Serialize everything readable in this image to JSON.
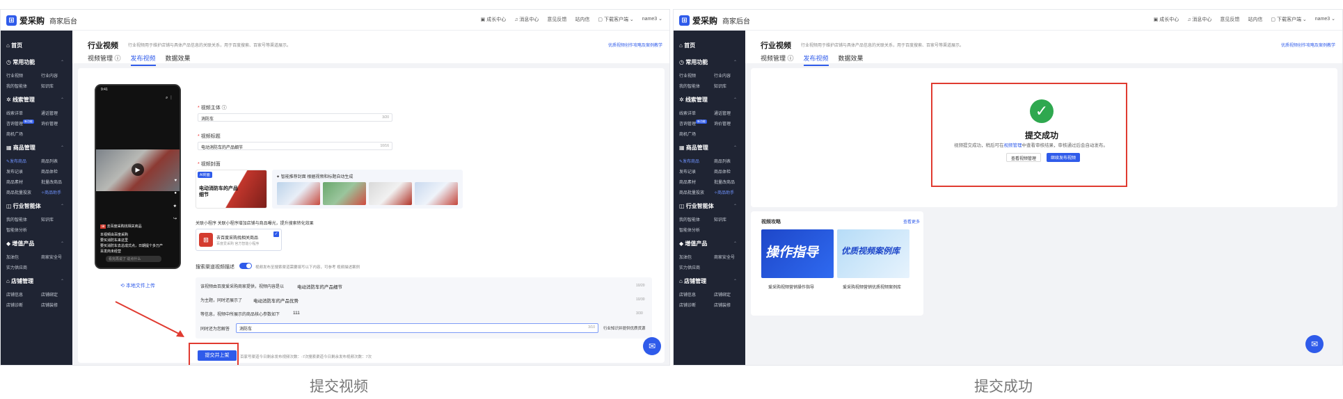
{
  "app": {
    "logo_text": "爱采购",
    "logo_sub": "商家后台",
    "top_nav": [
      "成长中心",
      "消息中心",
      "意见反馈",
      "站内信",
      "下载客户端",
      "name3"
    ]
  },
  "sidebar": {
    "home": "首页",
    "groups": [
      {
        "title": "常用功能",
        "items": [
          "行业视频",
          "行业内容",
          "我的智能体",
          "知识库"
        ]
      },
      {
        "title": "线索管理",
        "items": [
          "线索详单",
          "通话管理",
          "咨询管理",
          "询价管理",
          "商机广场"
        ],
        "badge": "新功能"
      },
      {
        "title": "商品管理",
        "items": [
          "发布商品",
          "商品列表",
          "发布记录",
          "商品体检",
          "商品素材",
          "批量改商品",
          "商品批量投放",
          "商品助手"
        ]
      },
      {
        "title": "行业智能体",
        "items": [
          "我的智能体",
          "知识库",
          "智能体分析"
        ]
      },
      {
        "title": "增值产品",
        "items": [
          "加油包",
          "商家安全号",
          "实力供应商"
        ]
      },
      {
        "title": "店铺管理",
        "items": [
          "店铺信息",
          "店铺绑定",
          "店铺诊断",
          "店铺装修"
        ]
      }
    ]
  },
  "header": {
    "title": "行业视频",
    "desc": "行业视频用于维护店铺与具体产品信息的关联关系，用于百度搜索、百家号等渠道展示。",
    "link": "优质视频创作攻略及案例教学",
    "tabs": [
      "视频管理 ⓘ",
      "发布视频",
      "数据效果"
    ]
  },
  "form": {
    "subject_label": "视频主体 ⓘ",
    "subject_value": "消防车",
    "subject_count": "3/20",
    "title_label": "视频标题",
    "title_value": "电动消防车的产品细节",
    "title_count": "10/16",
    "cover_label": "视频封面",
    "cover_tag": "AI封面",
    "cover_title": "电动消防车的产品细节",
    "smart_cover_title": "智能推荐封面 根据视频和标题自动生成",
    "mini_label": "关联小程序 关联小程序增加店铺与商品曝光，提升搜索转化效果",
    "mini_name": "去百度采购找相关商品",
    "mini_sub": "百度爱采购 官方智能小程序",
    "search_desc_label": "搜索渠道视频描述",
    "search_desc_hint": "视频发布至搜索渠道需要填写以下内容，可参考 视频描述案例",
    "rows": [
      {
        "label": "该视频由百度爱采购商家提供，视频内容是以",
        "value": "电动消防车的产品细节",
        "count": "10/20"
      },
      {
        "label": "为主题，同时还展示了",
        "value": "电动消防车的产品优势",
        "count": "10/30"
      },
      {
        "label": "等信息，视频中所展示的商品核心参数如下",
        "value": "111",
        "count": "3/30"
      },
      {
        "label": "同时还为您解答",
        "value": "消防车",
        "count": "3/10"
      }
    ],
    "row_side_text": "行业知识并提供优质货源",
    "submit_label": "提交并上架",
    "quota_1": "百家号渠道今日剩余发布视频次数：-7次",
    "quota_2": "搜索渠道今日剩余发布视频次数：7次",
    "upload_link": "本地文件上传"
  },
  "phone": {
    "time": "9:41",
    "tag": "去百度采购找相关商品",
    "line1": "本视频由百度采购",
    "line2": "要买消防车来这里",
    "line3": "要买消防车去总成式点，日期提个多万产",
    "line4": "百发商未经营",
    "input_placeholder": "看完再说了 说点什么"
  },
  "success": {
    "title": "提交成功",
    "desc_pre": "视频提交成功，稍后可在",
    "desc_link": "视频管理",
    "desc_post": "中查看审核结果，审核通过后会自动发布。",
    "btn_view": "查看视频管理",
    "btn_continue": "继续发布视频"
  },
  "guide": {
    "title": "视频攻略",
    "more": "查看更多",
    "card1_title": "操作指导",
    "card1_cap": "爱采购视频营销操作指导",
    "card2_title": "优质视频案例库",
    "card2_cap": "爱采购视频营销优质视频案例库"
  },
  "captions": {
    "left": "提交视频",
    "right": "提交成功"
  },
  "colors": {
    "accent": "#2f5bea",
    "success": "#2fa84f",
    "highlight": "#e03a30",
    "sidebar": "#1f2433"
  }
}
